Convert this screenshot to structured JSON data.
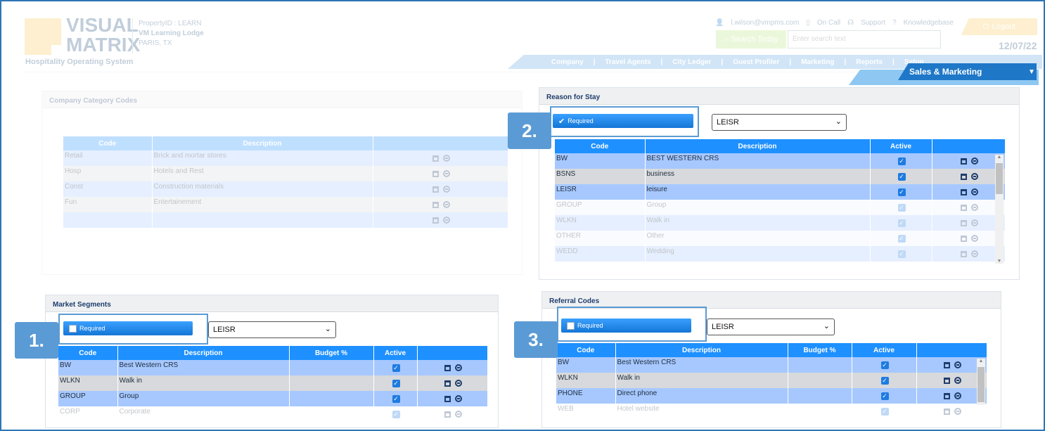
{
  "header": {
    "logo_line1": "VISUAL",
    "logo_line2": "MATRIX",
    "logo_sub": "Hospitality Operating System",
    "property_id": "PropertyID : LEARN",
    "property_name": "VM Learning Lodge",
    "property_city": "PARIS, TX",
    "user_email": "l.wilson@vmpms.com",
    "on_call": "On Call",
    "support": "Support",
    "knowledgebase": "Knowledgebase",
    "logout": "Logout",
    "search_button": "Search Today",
    "search_placeholder": "Enter search text",
    "date": "12/07/22",
    "nav": [
      "Company",
      "Travel Agents",
      "City Ledger",
      "Guest Profiler",
      "Marketing",
      "Reports",
      "Setup"
    ],
    "module_tab": "Sales & Marketing"
  },
  "company_category": {
    "title": "Company Category Codes",
    "columns": [
      "Code",
      "Description",
      ""
    ],
    "rows": [
      {
        "code": "Retail",
        "description": "Brick and mortar stores"
      },
      {
        "code": "Hosp",
        "description": "Hotels and Rest"
      },
      {
        "code": "Const",
        "description": "Construction materials"
      },
      {
        "code": "Fun",
        "description": "Entertainement"
      },
      {
        "code": "",
        "description": ""
      }
    ]
  },
  "reason_for_stay": {
    "title": "Reason for Stay",
    "badge": "2.",
    "required_label": "Required",
    "required_checked": true,
    "select_value": "LEISR",
    "columns": [
      "Code",
      "Description",
      "Active",
      ""
    ],
    "rows": [
      {
        "code": "BW",
        "description": "BEST WESTERN CRS"
      },
      {
        "code": "BSNS",
        "description": "business"
      },
      {
        "code": "LEISR",
        "description": "leisure"
      },
      {
        "code": "GROUP",
        "description": "Group"
      },
      {
        "code": "WLKN",
        "description": "Walk in"
      },
      {
        "code": "OTHER",
        "description": "Other"
      },
      {
        "code": "WEDD",
        "description": "Wedding"
      }
    ]
  },
  "market_segments": {
    "title": "Market Segments",
    "badge": "1.",
    "required_label": "Required",
    "required_checked": false,
    "select_value": "LEISR",
    "columns": [
      "Code",
      "Description",
      "Budget %",
      "Active",
      ""
    ],
    "rows": [
      {
        "code": "BW",
        "description": "Best Western CRS"
      },
      {
        "code": "WLKN",
        "description": "Walk in"
      },
      {
        "code": "GROUP",
        "description": "Group"
      },
      {
        "code": "CORP",
        "description": "Corporate"
      }
    ]
  },
  "referral_codes": {
    "title": "Referral Codes",
    "badge": "3.",
    "required_label": "Required",
    "required_checked": false,
    "select_value": "LEISR",
    "columns": [
      "Code",
      "Description",
      "Budget %",
      "Active",
      ""
    ],
    "rows": [
      {
        "code": "BW",
        "description": "Best Western CRS"
      },
      {
        "code": "WLKN",
        "description": "Walk in"
      },
      {
        "code": "PHONE",
        "description": "Direct phone"
      },
      {
        "code": "WEB",
        "description": "Hotel website"
      }
    ]
  }
}
